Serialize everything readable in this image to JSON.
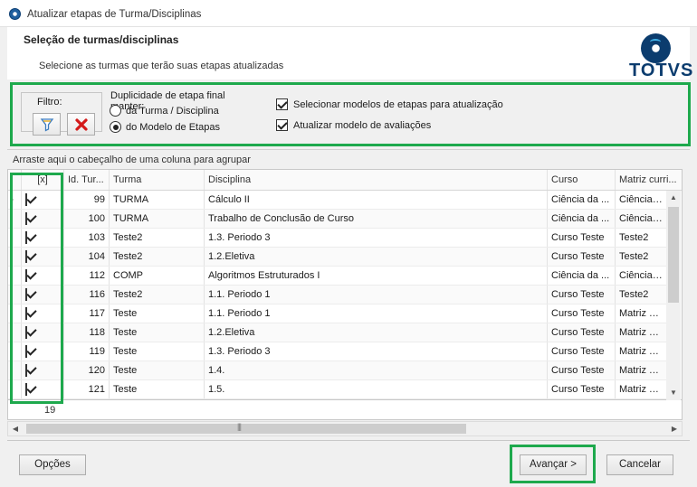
{
  "window": {
    "title": "Atualizar etapas de Turma/Disciplinas"
  },
  "header": {
    "title": "Seleção de turmas/disciplinas",
    "subtitle": "Selecione as turmas que terão suas etapas atualizadas",
    "logo_text": "TOTVS"
  },
  "filter": {
    "label": "Filtro:",
    "filter_icon": "funnel-icon",
    "clear_icon": "red-x-icon"
  },
  "duplicity": {
    "title": "Duplicidade de etapa final manter:",
    "options": [
      {
        "label": "da Turma / Disciplina",
        "selected": false
      },
      {
        "label": "do Modelo de Etapas",
        "selected": true
      }
    ]
  },
  "checkboxes": [
    {
      "label": "Selecionar modelos de etapas para atualização",
      "checked": true
    },
    {
      "label": "Atualizar modelo de avaliações",
      "checked": true
    }
  ],
  "group_bar": {
    "text": "Arraste aqui o cabeçalho de uma coluna para agrupar"
  },
  "grid": {
    "columns": [
      "[x]",
      "Id. Tur...",
      "Turma",
      "Disciplina",
      "Curso",
      "Matriz curri..."
    ],
    "rows": [
      {
        "checked": true,
        "id": "99",
        "turma": "TURMA",
        "disciplina": "Cálculo II",
        "curso": "Ciência da ...",
        "matriz": "Ciência da"
      },
      {
        "checked": true,
        "id": "100",
        "turma": "TURMA",
        "disciplina": "Trabalho de Conclusão de Curso",
        "curso": "Ciência da ...",
        "matriz": "Ciência da"
      },
      {
        "checked": true,
        "id": "103",
        "turma": "Teste2",
        "disciplina": "1.3. Periodo 3",
        "curso": "Curso Teste",
        "matriz": "Teste2"
      },
      {
        "checked": true,
        "id": "104",
        "turma": "Teste2",
        "disciplina": "1.2.Eletiva",
        "curso": "Curso Teste",
        "matriz": "Teste2"
      },
      {
        "checked": true,
        "id": "112",
        "turma": "COMP",
        "disciplina": "Algoritmos Estruturados I",
        "curso": "Ciência da ...",
        "matriz": "Ciência da"
      },
      {
        "checked": true,
        "id": "116",
        "turma": "Teste2",
        "disciplina": "1.1. Periodo 1",
        "curso": "Curso Teste",
        "matriz": "Teste2"
      },
      {
        "checked": true,
        "id": "117",
        "turma": "Teste",
        "disciplina": "1.1. Periodo 1",
        "curso": "Curso Teste",
        "matriz": "Matriz Test"
      },
      {
        "checked": true,
        "id": "118",
        "turma": "Teste",
        "disciplina": "1.2.Eletiva",
        "curso": "Curso Teste",
        "matriz": "Matriz Test"
      },
      {
        "checked": true,
        "id": "119",
        "turma": "Teste",
        "disciplina": "1.3. Periodo 3",
        "curso": "Curso Teste",
        "matriz": "Matriz Test"
      },
      {
        "checked": true,
        "id": "120",
        "turma": "Teste",
        "disciplina": "1.4.",
        "curso": "Curso Teste",
        "matriz": "Matriz Test"
      },
      {
        "checked": true,
        "id": "121",
        "turma": "Teste",
        "disciplina": "1.5.",
        "curso": "Curso Teste",
        "matriz": "Matriz Test"
      }
    ],
    "footer_count": "19"
  },
  "buttons": {
    "opcoes": "Opções",
    "avancar": "Avançar >",
    "cancelar": "Cancelar"
  },
  "colors": {
    "highlight": "#1ea94d",
    "logo": "#0b3c6e"
  }
}
